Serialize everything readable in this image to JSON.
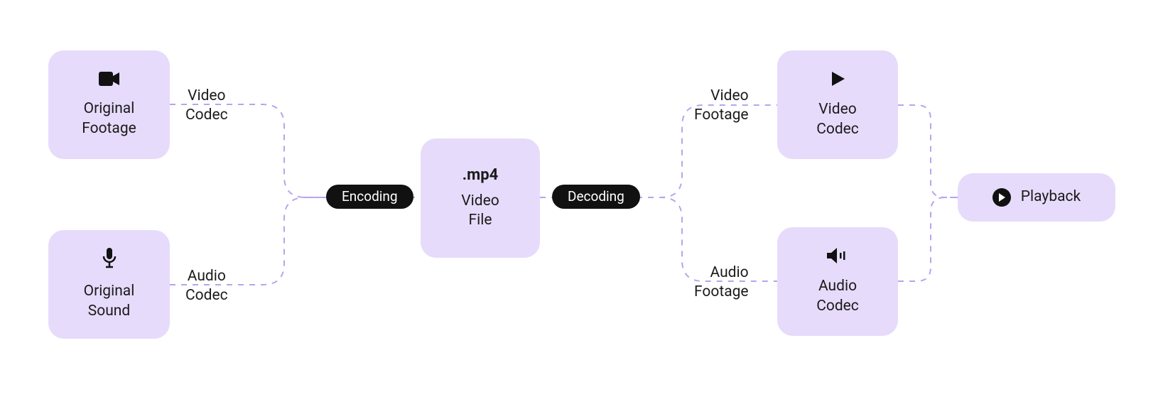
{
  "nodes": {
    "original_footage": {
      "label1": "Original",
      "label2": "Footage"
    },
    "original_sound": {
      "label1": "Original",
      "label2": "Sound"
    },
    "video_file": {
      "title": ".mp4",
      "label1": "Video",
      "label2": "File"
    },
    "video_codec": {
      "label1": "Video",
      "label2": "Codec"
    },
    "audio_codec": {
      "label1": "Audio",
      "label2": "Codec"
    },
    "playback": {
      "label": "Playback"
    }
  },
  "pills": {
    "encoding": "Encoding",
    "decoding": "Decoding"
  },
  "edge_labels": {
    "video_codec_in": {
      "l1": "Video",
      "l2": "Codec"
    },
    "audio_codec_in": {
      "l1": "Audio",
      "l2": "Codec"
    },
    "video_footage": {
      "l1": "Video",
      "l2": "Footage"
    },
    "audio_footage": {
      "l1": "Audio",
      "l2": "Footage"
    }
  }
}
